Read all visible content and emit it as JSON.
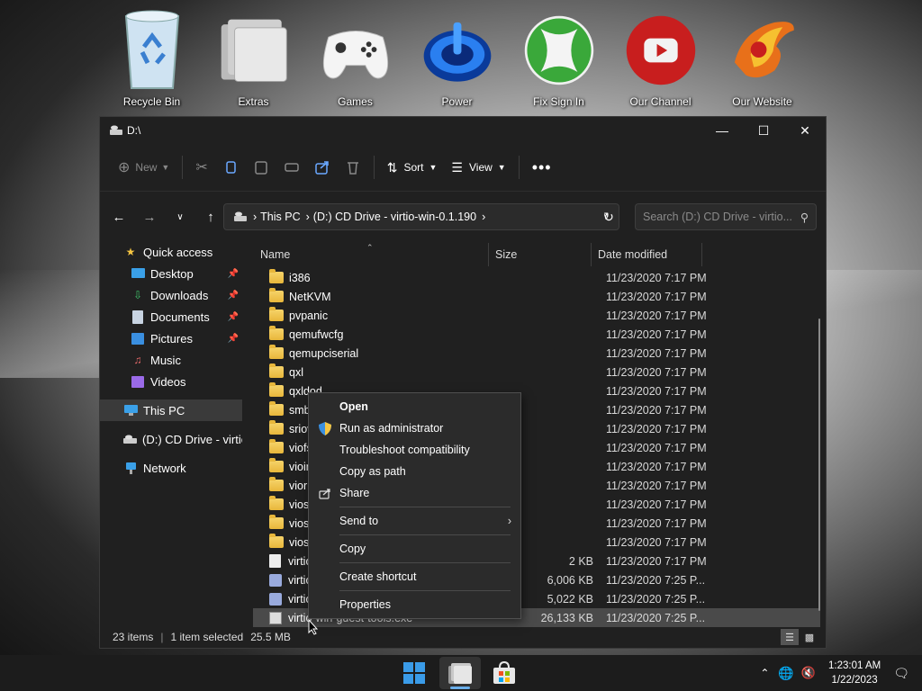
{
  "desktop": {
    "icons": [
      {
        "label": "Recycle Bin",
        "icon": "recycle-bin-icon"
      },
      {
        "label": "Extras",
        "icon": "folder-stack-icon"
      },
      {
        "label": "Games",
        "icon": "gamepad-icon"
      },
      {
        "label": "Power",
        "icon": "power-icon"
      },
      {
        "label": "Fix Sign In",
        "icon": "xbox-icon"
      },
      {
        "label": "Our Channel",
        "icon": "youtube-icon"
      },
      {
        "label": "Our Website",
        "icon": "phoenix-icon"
      }
    ]
  },
  "window": {
    "title": "D:\\",
    "toolbar": {
      "new_label": "New",
      "sort_label": "Sort",
      "view_label": "View"
    },
    "address": {
      "seg1": "This PC",
      "seg2": "(D:) CD Drive - virtio-win-0.1.190"
    },
    "search": {
      "placeholder": "Search (D:) CD Drive - virtio..."
    },
    "sidebar": {
      "quick_access": "Quick access",
      "desktop": "Desktop",
      "downloads": "Downloads",
      "documents": "Documents",
      "pictures": "Pictures",
      "music": "Music",
      "videos": "Videos",
      "this_pc": "This PC",
      "cd_drive": "(D:) CD Drive - virtio",
      "network": "Network"
    },
    "columns": {
      "name": "Name",
      "size": "Size",
      "date": "Date modified"
    },
    "files": [
      {
        "name": "i386",
        "size": "",
        "date": "11/23/2020 7:17 PM",
        "kind": "folder"
      },
      {
        "name": "NetKVM",
        "size": "",
        "date": "11/23/2020 7:17 PM",
        "kind": "folder"
      },
      {
        "name": "pvpanic",
        "size": "",
        "date": "11/23/2020 7:17 PM",
        "kind": "folder"
      },
      {
        "name": "qemufwcfg",
        "size": "",
        "date": "11/23/2020 7:17 PM",
        "kind": "folder"
      },
      {
        "name": "qemupciserial",
        "size": "",
        "date": "11/23/2020 7:17 PM",
        "kind": "folder"
      },
      {
        "name": "qxl",
        "size": "",
        "date": "11/23/2020 7:17 PM",
        "kind": "folder"
      },
      {
        "name": "qxldod",
        "size": "",
        "date": "11/23/2020 7:17 PM",
        "kind": "folder"
      },
      {
        "name": "smbus",
        "size": "",
        "date": "11/23/2020 7:17 PM",
        "kind": "folder"
      },
      {
        "name": "sriov",
        "size": "",
        "date": "11/23/2020 7:17 PM",
        "kind": "folder"
      },
      {
        "name": "viofs",
        "size": "",
        "date": "11/23/2020 7:17 PM",
        "kind": "folder"
      },
      {
        "name": "vioinput",
        "size": "",
        "date": "11/23/2020 7:17 PM",
        "kind": "folder"
      },
      {
        "name": "viorng",
        "size": "",
        "date": "11/23/2020 7:17 PM",
        "kind": "folder"
      },
      {
        "name": "vioscsi",
        "size": "",
        "date": "11/23/2020 7:17 PM",
        "kind": "folder"
      },
      {
        "name": "vioserial",
        "size": "",
        "date": "11/23/2020 7:17 PM",
        "kind": "folder"
      },
      {
        "name": "viostor",
        "size": "",
        "date": "11/23/2020 7:17 PM",
        "kind": "folder"
      },
      {
        "name": "virtio-win_license.txt",
        "size": "2 KB",
        "date": "11/23/2020 7:17 PM",
        "kind": "file"
      },
      {
        "name": "virtio-win-gt-x64.msi",
        "size": "6,006 KB",
        "date": "11/23/2020 7:25 P...",
        "kind": "msi"
      },
      {
        "name": "virtio-win-gt-x86.msi",
        "size": "5,022 KB",
        "date": "11/23/2020 7:25 P...",
        "kind": "msi"
      },
      {
        "name": "virtio-win-guest-tools.exe",
        "size": "26,133 KB",
        "date": "11/23/2020 7:25 P...",
        "kind": "exe"
      }
    ],
    "status": {
      "items": "23 items",
      "selected": "1 item selected",
      "size": "25.5 MB"
    }
  },
  "context_menu": {
    "open": "Open",
    "run_admin": "Run as administrator",
    "troubleshoot": "Troubleshoot compatibility",
    "copy_path": "Copy as path",
    "share": "Share",
    "send_to": "Send to",
    "copy": "Copy",
    "create_shortcut": "Create shortcut",
    "properties": "Properties"
  },
  "taskbar": {
    "time": "1:23:01 AM",
    "date": "1/22/2023"
  }
}
